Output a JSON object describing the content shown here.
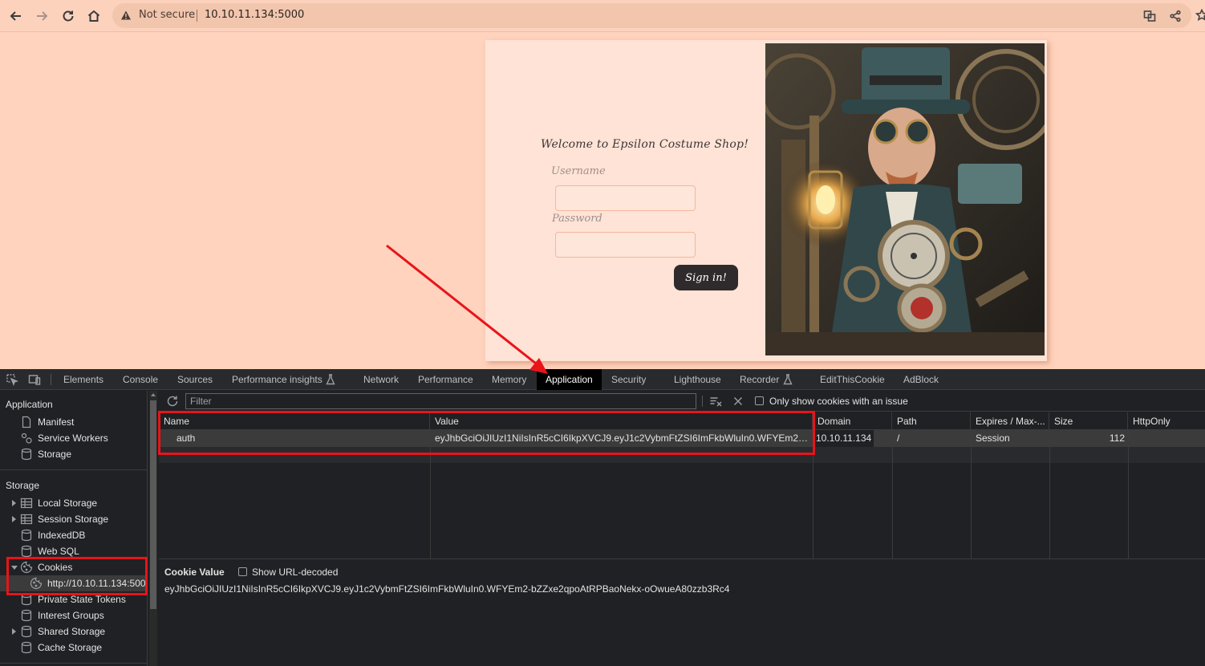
{
  "browser": {
    "security_label": "Not secure",
    "url": "10.10.11.134:5000"
  },
  "page": {
    "welcome": "Welcome to Epsilon Costume Shop!",
    "username_label": "Username",
    "password_label": "Password",
    "signin_label": "Sign in!"
  },
  "devtools": {
    "tabs": [
      "Elements",
      "Console",
      "Sources",
      "Performance insights",
      "Network",
      "Performance",
      "Memory",
      "Application",
      "Security",
      "Lighthouse",
      "Recorder",
      "EditThisCookie",
      "AdBlock"
    ],
    "active_tab": "Application",
    "sidebar": {
      "application_header": "Application",
      "application_items": [
        "Manifest",
        "Service Workers",
        "Storage"
      ],
      "storage_header": "Storage",
      "storage_items": [
        "Local Storage",
        "Session Storage",
        "IndexedDB",
        "Web SQL",
        "Cookies",
        "http://10.10.11.134:500",
        "Private State Tokens",
        "Interest Groups",
        "Shared Storage",
        "Cache Storage"
      ]
    },
    "toolbar": {
      "filter_placeholder": "Filter",
      "issue_checkbox_label": "Only show cookies with an issue"
    },
    "cookie_table": {
      "columns": [
        "Name",
        "Value",
        "Domain",
        "Path",
        "Expires / Max-...",
        "Size",
        "HttpOnly"
      ],
      "rows": [
        {
          "name": "auth",
          "value": "eyJhbGciOiJIUzI1NiIsInR5cCI6IkpXVCJ9.eyJ1c2VybmFtZSI6ImFkbWluIn0.WFYEm2…",
          "domain": "10.10.11.134",
          "path": "/",
          "expires": "Session",
          "size": "112",
          "httponly": ""
        }
      ]
    },
    "cookie_value_panel": {
      "title": "Cookie Value",
      "url_decoded_label": "Show URL-decoded",
      "value": "eyJhbGciOiJIUzI1NiIsInR5cCI6IkpXVCJ9.eyJ1c2VybmFtZSI6ImFkbWluIn0.WFYEm2-bZZxe2qpoAtRPBaoNekx-oOwueA80zzb3Rc4"
    }
  },
  "colors": {
    "page_bg": "#ffd3bd",
    "annotation_red": "#e8141a",
    "devtools_bg": "#202124"
  }
}
